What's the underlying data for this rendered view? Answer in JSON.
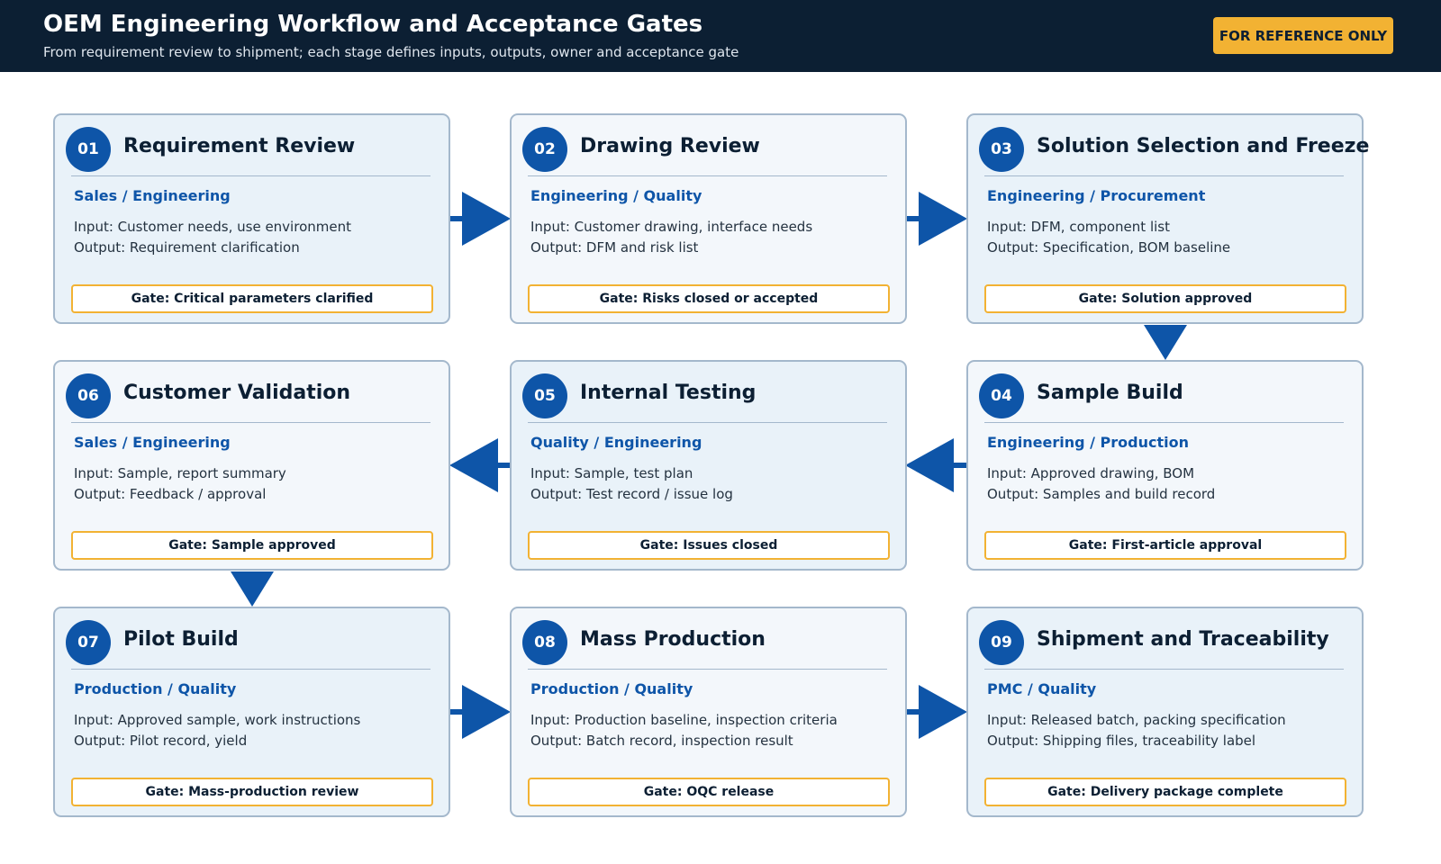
{
  "header": {
    "title": "OEM Engineering Workflow and Acceptance Gates",
    "subtitle": "From requirement review to shipment; each stage defines inputs, outputs, owner and acceptance gate",
    "badge": "FOR REFERENCE ONLY"
  },
  "stages": [
    {
      "num": "01",
      "title": "Requirement Review",
      "owner": "Sales / Engineering",
      "input": "Input: Customer needs, use environment",
      "output": "Output: Requirement clarification",
      "gate": "Gate: Critical parameters clarified"
    },
    {
      "num": "02",
      "title": "Drawing Review",
      "owner": "Engineering / Quality",
      "input": "Input: Customer drawing, interface needs",
      "output": "Output: DFM and risk list",
      "gate": "Gate: Risks closed or accepted"
    },
    {
      "num": "03",
      "title": "Solution Selection and Freeze",
      "owner": "Engineering / Procurement",
      "input": "Input: DFM, component list",
      "output": "Output: Specification, BOM baseline",
      "gate": "Gate: Solution approved"
    },
    {
      "num": "04",
      "title": "Sample Build",
      "owner": "Engineering / Production",
      "input": "Input: Approved drawing, BOM",
      "output": "Output: Samples and build record",
      "gate": "Gate: First-article approval"
    },
    {
      "num": "05",
      "title": "Internal Testing",
      "owner": "Quality / Engineering",
      "input": "Input: Sample, test plan",
      "output": "Output: Test record / issue log",
      "gate": "Gate: Issues closed"
    },
    {
      "num": "06",
      "title": "Customer Validation",
      "owner": "Sales / Engineering",
      "input": "Input: Sample, report summary",
      "output": "Output: Feedback / approval",
      "gate": "Gate: Sample approved"
    },
    {
      "num": "07",
      "title": "Pilot Build",
      "owner": "Production / Quality",
      "input": "Input: Approved sample, work instructions",
      "output": "Output: Pilot record, yield",
      "gate": "Gate: Mass-production review"
    },
    {
      "num": "08",
      "title": "Mass Production",
      "owner": "Production / Quality",
      "input": "Input: Production baseline, inspection criteria",
      "output": "Output: Batch record, inspection result",
      "gate": "Gate: OQC release"
    },
    {
      "num": "09",
      "title": "Shipment and Traceability",
      "owner": "PMC / Quality",
      "input": "Input: Released batch, packing specification",
      "output": "Output: Shipping files, traceability label",
      "gate": "Gate: Delivery package complete"
    }
  ],
  "colors": {
    "header_bg": "#0c1f33",
    "accent_blue": "#0e55a8",
    "gate_border": "#f2b233",
    "card_border": "#a4b8cc"
  }
}
